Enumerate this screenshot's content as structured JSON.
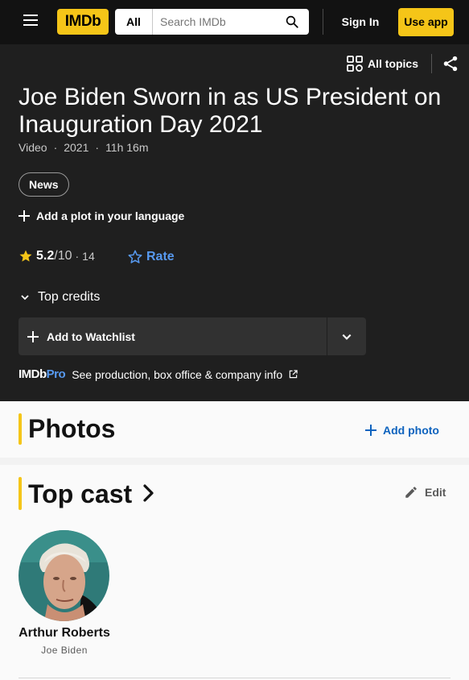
{
  "nav": {
    "logo": "IMDb",
    "search_category": "All",
    "search_placeholder": "Search IMDb",
    "sign_in": "Sign In",
    "use_app": "Use app"
  },
  "hero": {
    "all_topics": "All topics",
    "title": "Joe Biden Sworn in as US President on Inauguration Day 2021",
    "meta": [
      "Video",
      "2021",
      "11h 16m"
    ],
    "genre_chip": "News",
    "add_plot": "Add a plot in your language",
    "rating": {
      "score": "5.2",
      "out_of": "/10",
      "separator": "·",
      "count": "14"
    },
    "rate_label": "Rate",
    "top_credits": "Top credits",
    "watchlist": "Add to Watchlist",
    "pro_logo_a": "IMDb",
    "pro_logo_b": "Pro",
    "pro_text": "See production, box office & company info"
  },
  "photos": {
    "title": "Photos",
    "add_photo": "Add photo"
  },
  "cast": {
    "title": "Top cast",
    "edit": "Edit",
    "members": [
      {
        "name": "Arthur Roberts",
        "character": "Joe Biden"
      }
    ]
  },
  "colors": {
    "brand_yellow": "#f5c518",
    "link_blue": "#5799ef",
    "action_blue": "#0e63be",
    "dark_bg": "#1f1f1f",
    "nav_bg": "#121212"
  }
}
